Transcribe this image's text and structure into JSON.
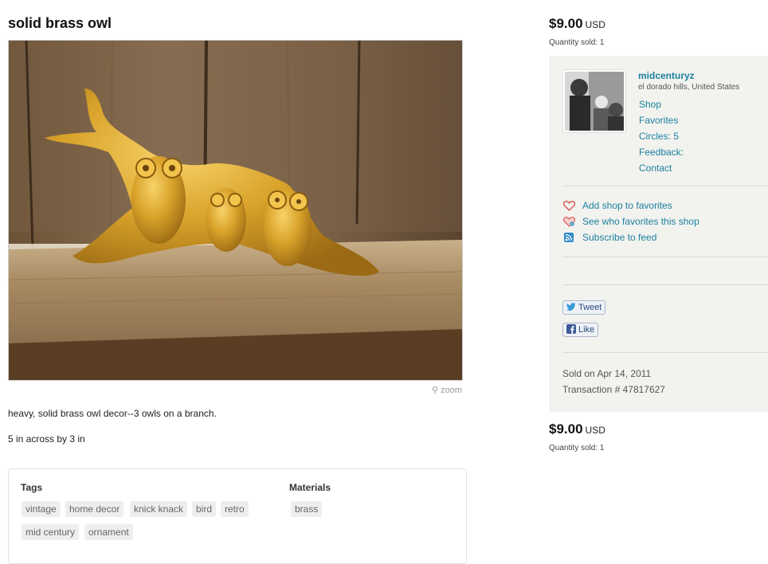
{
  "listing": {
    "title": "solid brass owl",
    "zoom_label": "zoom",
    "description_1": "heavy, solid brass owl decor--3 owls on a branch.",
    "description_2": "5 in across by 3 in"
  },
  "tags_section": {
    "tags_heading": "Tags",
    "tags": [
      "vintage",
      "home decor",
      "knick knack",
      "bird",
      "retro",
      "mid century",
      "ornament"
    ],
    "materials_heading": "Materials",
    "materials": [
      "brass"
    ]
  },
  "price_top": {
    "amount": "$9.00",
    "currency": "USD",
    "quantity": "Quantity sold: 1"
  },
  "price_bottom": {
    "amount": "$9.00",
    "currency": "USD",
    "quantity": "Quantity sold: 1"
  },
  "shop": {
    "seller_name": "midcenturyz",
    "location": "el dorado hills, United States",
    "links": [
      "Shop",
      "Favorites",
      "Circles: 5",
      "Feedback:",
      "Contact"
    ],
    "actions": {
      "add_favorites": "Add shop to favorites",
      "see_favorites": "See who favorites this shop",
      "subscribe": "Subscribe to feed"
    },
    "social": {
      "tweet": "Tweet",
      "like": "Like"
    },
    "sold_on": "Sold on Apr 14, 2011",
    "transaction": "Transaction # 47817627"
  },
  "colors": {
    "link": "#1b82a0",
    "panel_bg": "#f2f2ee",
    "tag_bg": "#eeeeee"
  },
  "icons": [
    "heart-icon",
    "heart-broken-icon",
    "rss-icon",
    "twitter-bird-icon",
    "facebook-icon",
    "magnifier-icon"
  ]
}
